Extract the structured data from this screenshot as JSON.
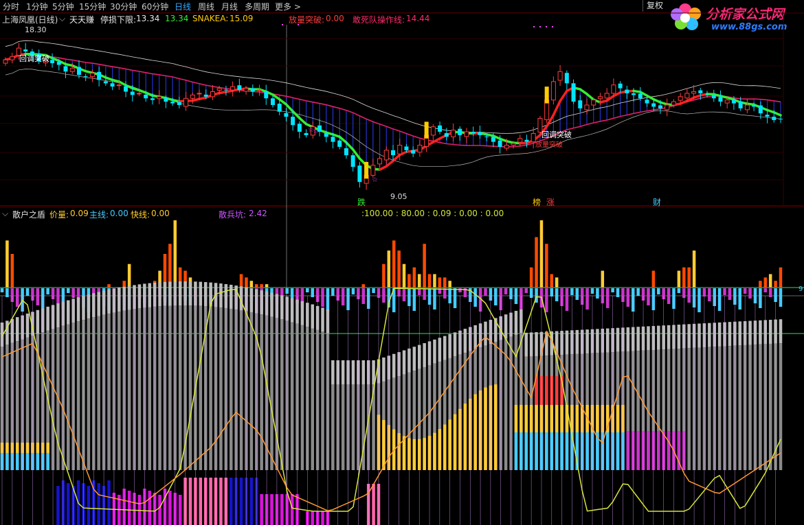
{
  "toolbar": {
    "periods": [
      "分时",
      "1分钟",
      "5分钟",
      "15分钟",
      "30分钟",
      "60分钟",
      "日线",
      "周线",
      "月线",
      "多周期",
      "更多 >"
    ],
    "active_index": 6,
    "restore_label": "复权"
  },
  "logo": {
    "name": "分析家公式网",
    "url": "www.88gs.com"
  },
  "main_panel": {
    "stock_title": "上海凤凰(日线)",
    "indicator_name": "天天赚",
    "stop_loss_label": "停损下限:",
    "stop_loss_value": "13.34",
    "value2": "13.34",
    "snakea_label": "SNAKEA:",
    "snakea_value": "15.09",
    "breakout_label": "放量突破:",
    "breakout_value": "0.00",
    "line_label": "敢死队操作线:",
    "line_value": "14.44",
    "high_marker": "18.30",
    "low_marker": "9.05",
    "annotations": [
      "回调突破",
      "回调突破",
      "跌",
      "榜",
      "涨",
      "财"
    ],
    "breakout_box": "放量突破"
  },
  "sub_panel": {
    "title": "散户之盾",
    "price_label": "价量:",
    "price_value": "0.09",
    "main_label": "主线:",
    "main_value": "0.00",
    "fast_label": "快线:",
    "fast_value": "0.00",
    "retail_label": "散兵坑:",
    "retail_value": "2.42",
    "readout": ":100.00 : 80.00 : 0.09 : 0.00 : 0.00",
    "right_edge_label": "9"
  },
  "colors": {
    "background": "#000000",
    "up": "#ff3c3c",
    "down": "#00e5ff",
    "ma_green": "#33ee33",
    "ma_red": "#ff2020",
    "ma_pink": "#e0206a",
    "cloud_blue": "#2233cc",
    "bar_orange": "#ff4a00",
    "bar_yellow": "#ffcc33",
    "bar_gray": "#8a8a8a",
    "bar_lightgray": "#bdbdbd",
    "bar_cyan": "#44ccff",
    "bar_magenta": "#cc33cc",
    "bar_blue": "#1414cc",
    "line_yellow": "#d6e63a",
    "line_orange": "#ff9933",
    "line_violet": "#d8a0ff"
  },
  "chart_data": [
    {
      "type": "candlestick",
      "title": "上海凤凰(日线)",
      "price_range": [
        8.5,
        19.0
      ],
      "close": [
        16.9,
        17.1,
        17.6,
        17.4,
        17.2,
        16.8,
        16.9,
        16.7,
        16.6,
        16.2,
        16.4,
        16.0,
        15.9,
        16.1,
        15.7,
        15.5,
        15.3,
        15.4,
        15.0,
        14.8,
        14.9,
        14.6,
        14.5,
        14.7,
        14.4,
        14.3,
        14.2,
        14.6,
        14.8,
        14.9,
        14.7,
        15.0,
        15.2,
        15.1,
        15.3,
        15.1,
        15.2,
        15.0,
        15.1,
        14.6,
        14.2,
        13.8,
        13.5,
        13.0,
        12.6,
        12.4,
        12.9,
        12.6,
        12.3,
        12.0,
        11.7,
        11.2,
        10.5,
        9.6,
        10.0,
        10.6,
        11.0,
        11.5,
        11.2,
        11.8,
        11.5,
        11.3,
        11.8,
        12.4,
        12.9,
        12.6,
        12.3,
        12.7,
        12.4,
        12.6,
        12.5,
        12.4,
        12.3,
        12.0,
        11.7,
        11.8,
        11.9,
        12.2,
        12.0,
        12.5,
        13.4,
        14.5,
        15.6,
        16.2,
        15.5,
        14.4,
        14.0,
        14.2,
        14.5,
        14.7,
        14.9,
        15.4,
        15.2,
        14.9,
        14.8,
        14.6,
        14.3,
        14.1,
        14.0,
        14.2,
        14.4,
        14.7,
        14.9,
        15.0,
        14.9,
        14.8,
        14.6,
        14.4,
        14.5,
        14.3,
        14.0,
        14.2,
        14.1,
        13.7,
        13.5,
        13.3,
        13.34
      ]
    },
    {
      "type": "bar",
      "title": "散户之盾",
      "series": [
        {
          "name": "价量",
          "values": [
            0.09
          ]
        },
        {
          "name": "主线",
          "values": [
            0.0
          ]
        },
        {
          "name": "快线",
          "values": [
            0.0
          ]
        },
        {
          "name": "散兵坑",
          "values": [
            2.42
          ]
        }
      ],
      "volume_spikes": [
        0,
        0.7,
        0.5,
        0,
        0,
        0,
        0,
        0,
        0,
        0,
        0,
        0,
        0,
        0,
        0,
        0,
        0,
        0,
        0,
        0,
        0,
        0.05,
        0,
        0,
        0.1,
        0.35,
        0,
        0,
        0,
        0,
        0.1,
        0.25,
        0.5,
        0.65,
        1.0,
        0.3,
        0.25,
        0.15,
        0,
        0,
        0,
        0,
        0,
        0,
        0,
        0,
        0,
        0.2,
        0.15,
        0.1,
        0.05,
        0.05,
        0.05,
        0,
        0,
        0,
        0,
        0,
        0,
        0,
        0,
        0,
        0,
        0,
        0,
        0,
        0,
        0,
        0,
        0,
        0,
        0.05,
        0,
        0,
        0,
        0.35,
        0.55,
        0.7,
        0.55,
        0.35,
        0.2,
        0.3,
        0.2,
        0.65,
        0.2,
        0.2,
        0.15,
        0.15,
        0.1,
        0,
        0,
        0,
        0,
        0,
        0,
        0,
        0,
        0,
        0,
        0,
        0,
        0,
        0,
        0,
        0.3,
        0.75,
        1.0,
        0.65,
        0.2,
        0.15,
        0,
        0,
        0,
        0,
        0,
        0,
        0,
        0,
        0.25,
        0,
        0,
        0,
        0,
        0,
        0,
        0,
        0,
        0,
        0.25,
        0,
        0,
        0,
        0,
        0.25,
        0.3,
        0.3,
        0.55,
        0,
        0,
        0,
        0,
        0,
        0,
        0,
        0,
        0,
        0,
        0,
        0,
        0.1,
        0.15,
        0.2,
        0.1,
        0.3
      ]
    }
  ]
}
